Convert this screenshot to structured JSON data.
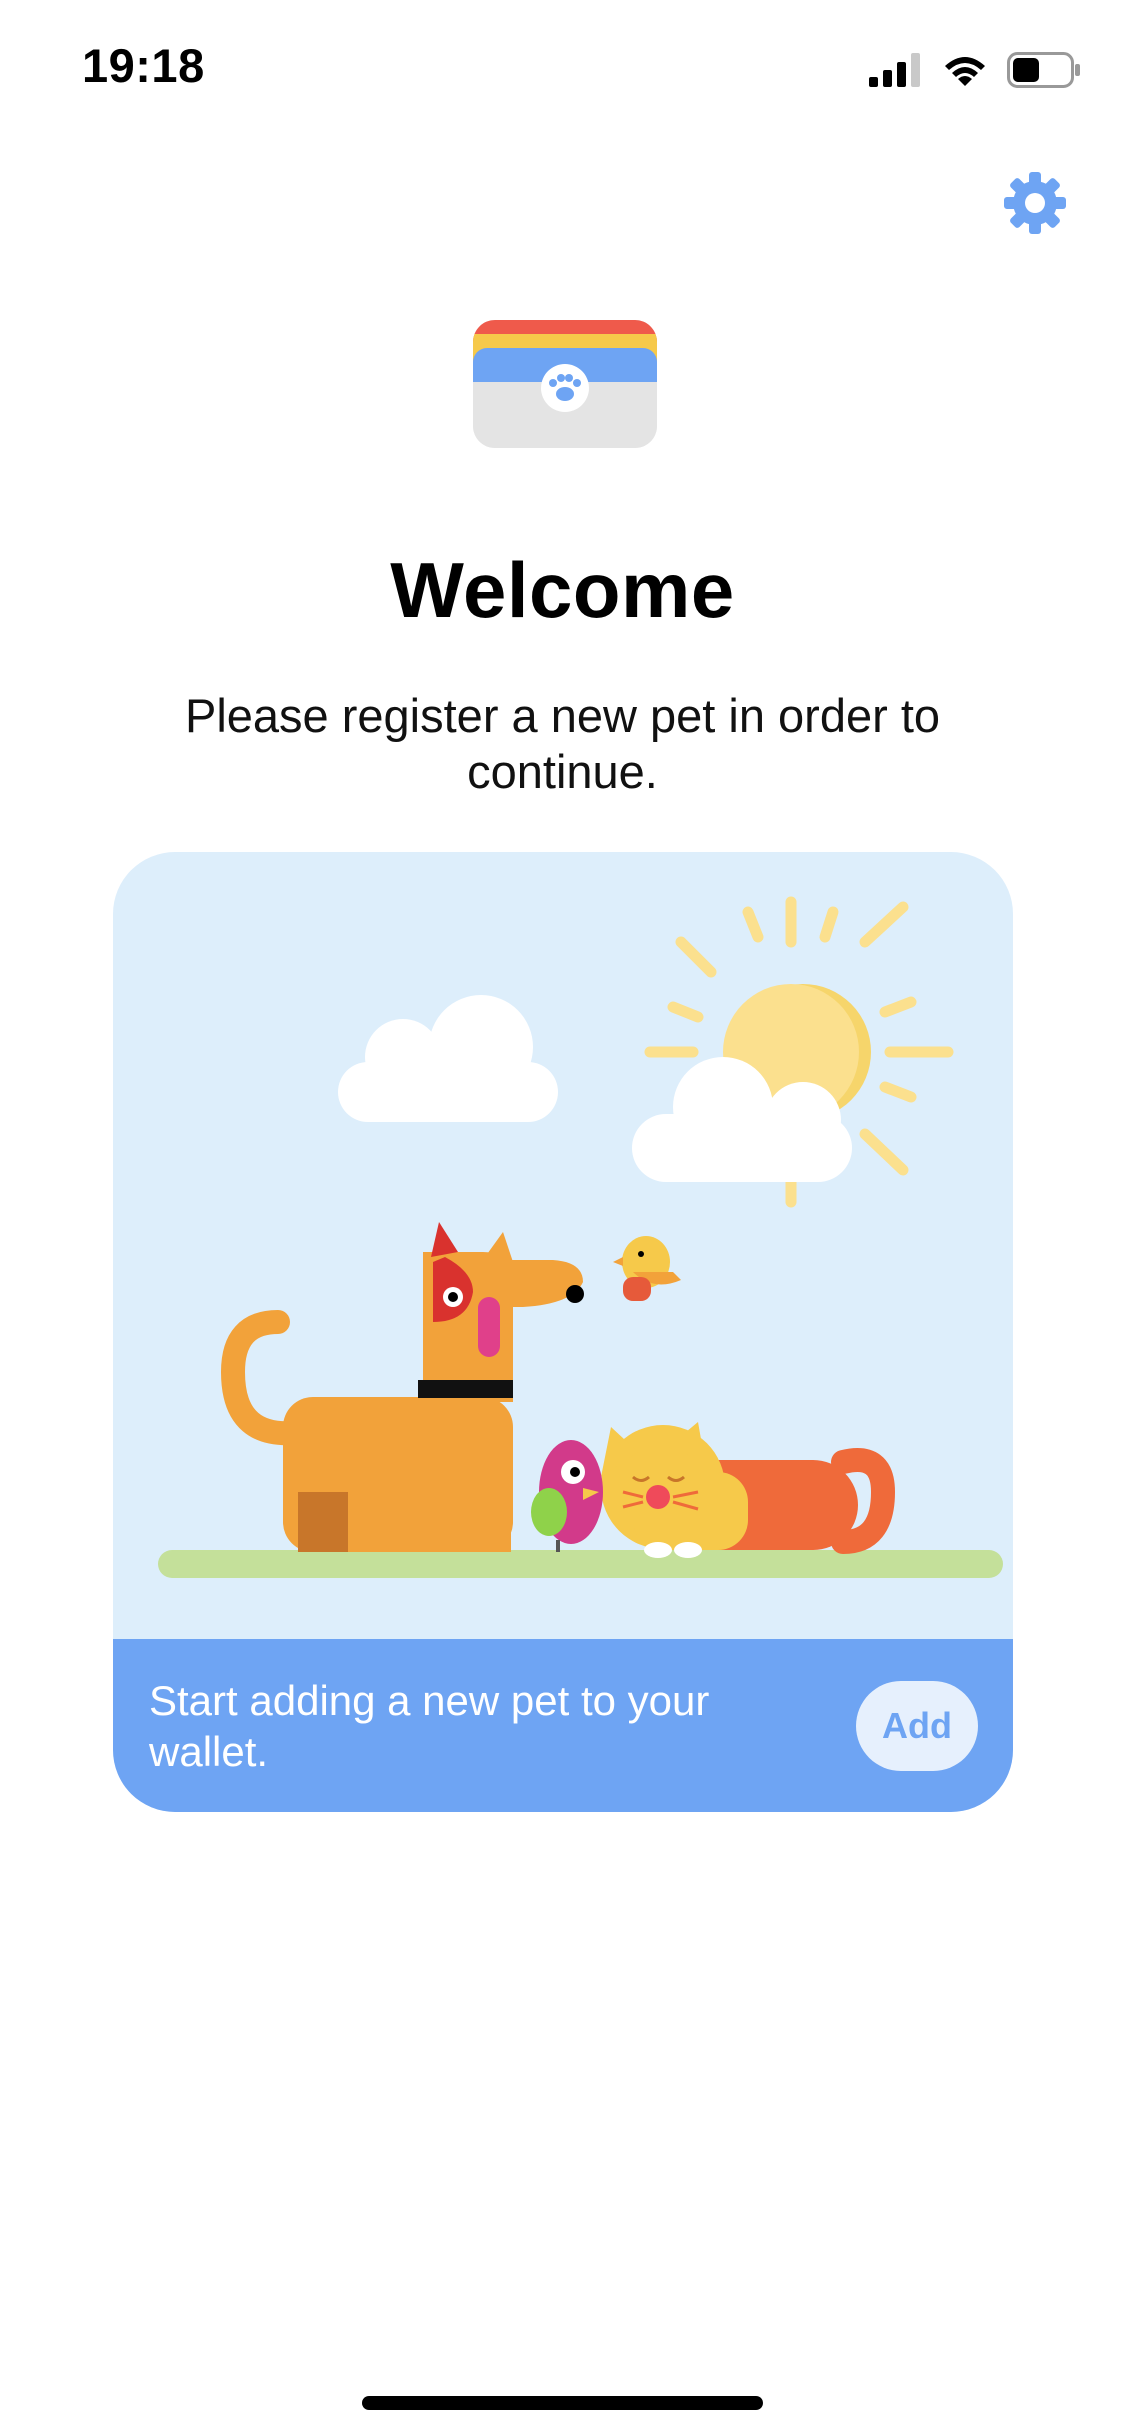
{
  "status_bar": {
    "time": "19:18",
    "icons": [
      "cellular-signal-icon",
      "wifi-icon",
      "battery-icon"
    ]
  },
  "header": {
    "settings_icon": "gear-icon",
    "accent_color": "#6ea4f3"
  },
  "welcome": {
    "title": "Welcome",
    "subtitle": "Please register a new pet in order to continue."
  },
  "card": {
    "illustration_icons": [
      "sun-icon",
      "cloud-icon",
      "dog-icon",
      "cat-icon",
      "bird-icon"
    ],
    "footer_text": "Start adding a new pet to your wallet.",
    "add_label": "Add"
  },
  "colors": {
    "accent": "#6ea4f3",
    "card_background": "#ddeefb",
    "button_background": "#e6f0fd"
  }
}
